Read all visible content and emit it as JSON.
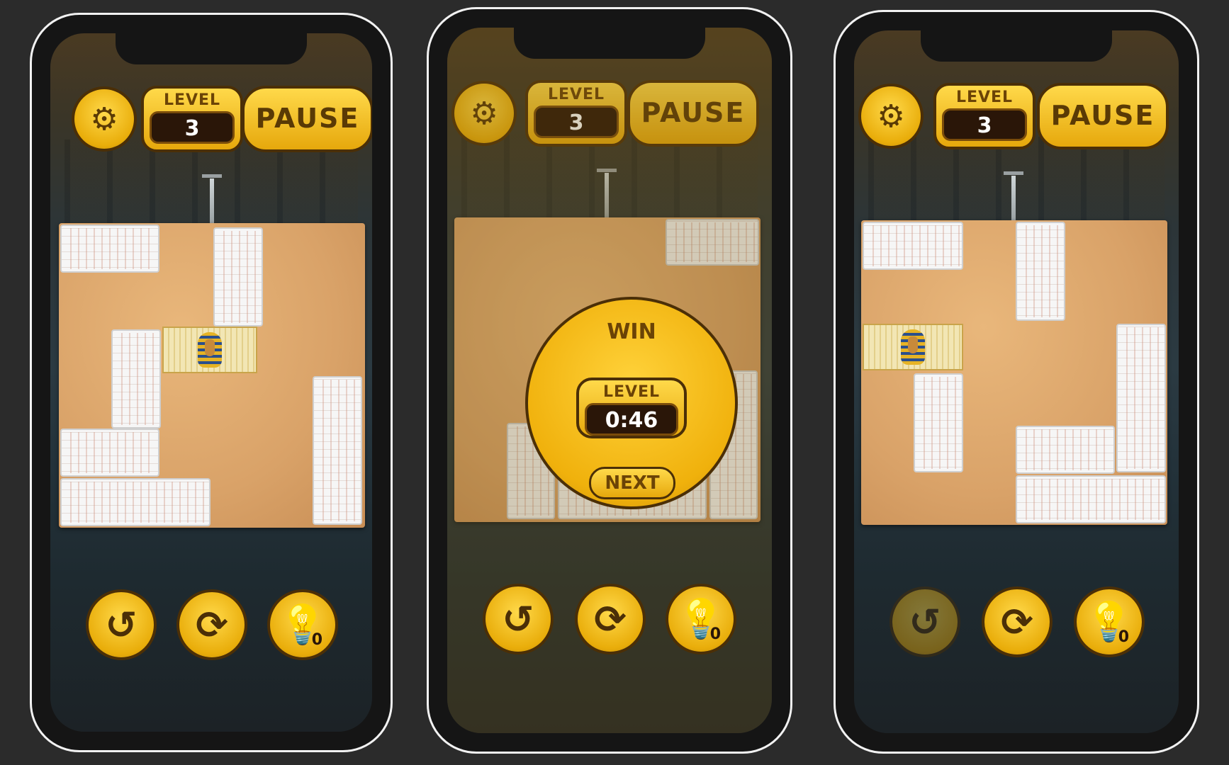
{
  "screens": [
    {
      "settings_icon": "gear-icon",
      "level_label": "LEVEL",
      "level_value": "3",
      "pause_label": "PAUSE",
      "controls": {
        "undo_icon": "undo-icon",
        "restart_icon": "restart-icon",
        "hint_icon": "lightbulb-icon",
        "hint_count": "0"
      }
    },
    {
      "settings_icon": "gear-icon",
      "level_label": "LEVEL",
      "level_value": "3",
      "pause_label": "PAUSE",
      "win": {
        "title": "WIN",
        "level_label": "LEVEL",
        "time": "0:46",
        "next_label": "NEXT"
      },
      "controls": {
        "undo_icon": "undo-icon",
        "restart_icon": "restart-icon",
        "hint_icon": "lightbulb-icon",
        "hint_count": "0"
      }
    },
    {
      "settings_icon": "gear-icon",
      "level_label": "LEVEL",
      "level_value": "3",
      "pause_label": "PAUSE",
      "controls": {
        "undo_icon": "undo-icon",
        "restart_icon": "restart-icon",
        "hint_icon": "lightbulb-icon",
        "hint_count": "0"
      }
    }
  ],
  "colors": {
    "gold": "#f0b10c",
    "dark_brown": "#4b2f07",
    "board": "#d9a268",
    "tile": "#f4f4f4"
  }
}
